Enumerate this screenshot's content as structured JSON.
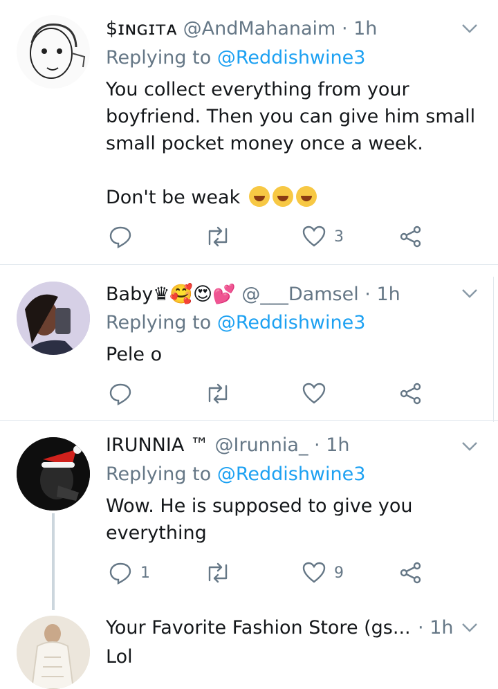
{
  "colors": {
    "accent": "#1da1f2",
    "muted": "#657786",
    "divider": "#e1e8ed"
  },
  "tweets": [
    {
      "name": "$ɪɴɢɪᴛᴀ",
      "handle": "@AndMahanaim",
      "dot": "·",
      "time": "1h",
      "replying_prefix": "Replying to",
      "replying_to": "@Reddishwine3",
      "text_lines": [
        "You collect everything from your",
        "boyfriend. Then you can give him small",
        "small pocket money once a week.",
        "",
        "Don't be weak"
      ],
      "emoji": [
        "rofl-emoji",
        "rofl-emoji",
        "rofl-emoji"
      ],
      "reply_count": "",
      "retweet_count": "",
      "like_count": "3"
    },
    {
      "name": "Baby",
      "name_emoji": "♛🥰😍💕",
      "handle": "@___Damsel",
      "dot": "·",
      "time": "1h",
      "replying_prefix": "Replying to",
      "replying_to": "@Reddishwine3",
      "text_lines": [
        "Pele o"
      ],
      "reply_count": "",
      "retweet_count": "",
      "like_count": ""
    },
    {
      "name": "IRUNNIA ™",
      "handle": "@Irunnia_",
      "dot": "·",
      "time": "1h",
      "replying_prefix": "Replying to",
      "replying_to": "@Reddishwine3",
      "text_lines": [
        "Wow. He is supposed to give you",
        "everything"
      ],
      "reply_count": "1",
      "retweet_count": "",
      "like_count": "9"
    },
    {
      "name": "Your Favorite Fashion Store (gs...",
      "dot": "·",
      "time": "1h",
      "text_lines": [
        "Lol"
      ]
    }
  ]
}
